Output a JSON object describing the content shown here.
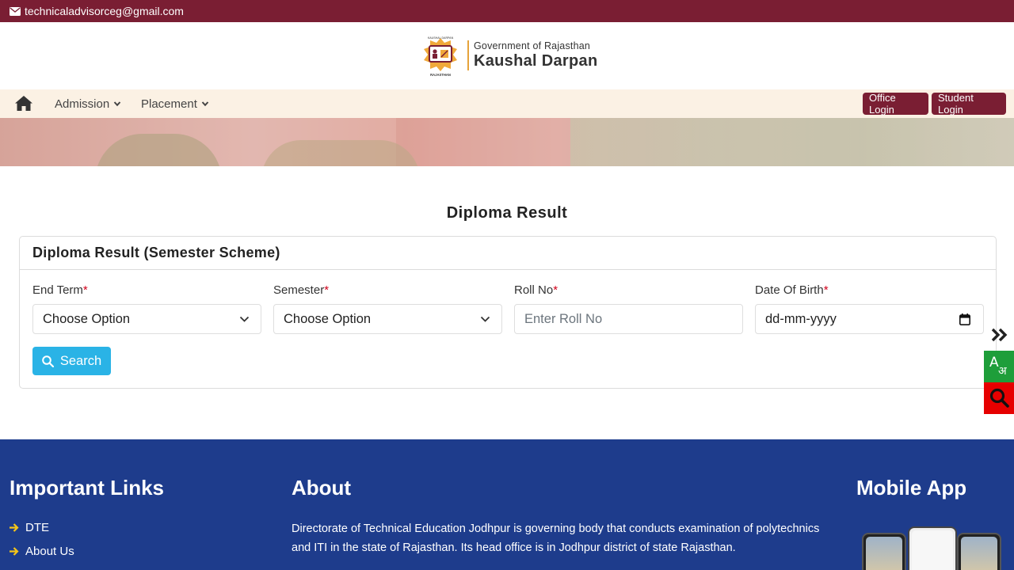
{
  "topbar": {
    "email": "technicaladvisorceg@gmail.com"
  },
  "logo": {
    "badge_top": "KAUSHAL DARPAN",
    "badge_bottom": "RAJASTHAN",
    "subtitle": "Government of Rajasthan",
    "title": "Kaushal Darpan"
  },
  "nav": {
    "items": [
      {
        "label": "Admission"
      },
      {
        "label": "Placement"
      }
    ],
    "office_login": "Office Login",
    "student_login": "Student Login"
  },
  "main": {
    "page_title": "Diploma Result",
    "card_title": "Diploma Result (Semester Scheme)",
    "fields": [
      {
        "label": "End Term",
        "required_mark": "*",
        "value": "Choose Option"
      },
      {
        "label": "Semester",
        "required_mark": "*",
        "value": "Choose Option"
      },
      {
        "label": "Roll No",
        "required_mark": "*",
        "placeholder": "Enter Roll No"
      },
      {
        "label": "Date Of Birth",
        "required_mark": "*",
        "placeholder": "dd-mm-yyyy"
      }
    ],
    "search_label": "Search"
  },
  "side": {
    "lang_glyph_a": "A",
    "lang_glyph_hi": "अ"
  },
  "footer": {
    "links_heading": "Important Links",
    "links": [
      "DTE",
      "About Us"
    ],
    "about_heading": "About",
    "about_text": "Directorate of Technical Education Jodhpur is governing body that conducts examination of polytechnics and ITI in the state of Rajasthan. Its head office is in Jodhpur district of state Rajasthan.",
    "app_heading": "Mobile App"
  },
  "colors": {
    "maroon": "#7a1e33",
    "nav_bg": "#fbf1e4",
    "search_button": "#2ab3e6",
    "footer_bg": "#1e3c8c",
    "lang_widget": "#1e9e3a",
    "search_widget": "#e60000"
  }
}
